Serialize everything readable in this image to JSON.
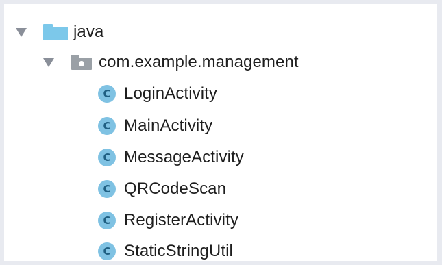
{
  "tree": {
    "root": {
      "label": "java",
      "icon": "folder-blue-icon",
      "expanded": true
    },
    "package": {
      "label": "com.example.management",
      "icon": "package-folder-icon",
      "expanded": true
    },
    "classes": [
      {
        "label": "LoginActivity",
        "icon_letter": "C"
      },
      {
        "label": "MainActivity",
        "icon_letter": "C"
      },
      {
        "label": "MessageActivity",
        "icon_letter": "C"
      },
      {
        "label": "QRCodeScan",
        "icon_letter": "C"
      },
      {
        "label": "RegisterActivity",
        "icon_letter": "C"
      },
      {
        "label": "StaticStringUtil",
        "icon_letter": "C"
      }
    ]
  },
  "colors": {
    "background": "#e8eaf0",
    "panel": "#ffffff",
    "folder_blue": "#7cc8ea",
    "folder_gray": "#9aa0a6",
    "class_icon_bg": "#7fc2e3",
    "class_icon_fg": "#1f5f82",
    "arrow": "#8a8f99",
    "text": "#1e1e1e"
  }
}
